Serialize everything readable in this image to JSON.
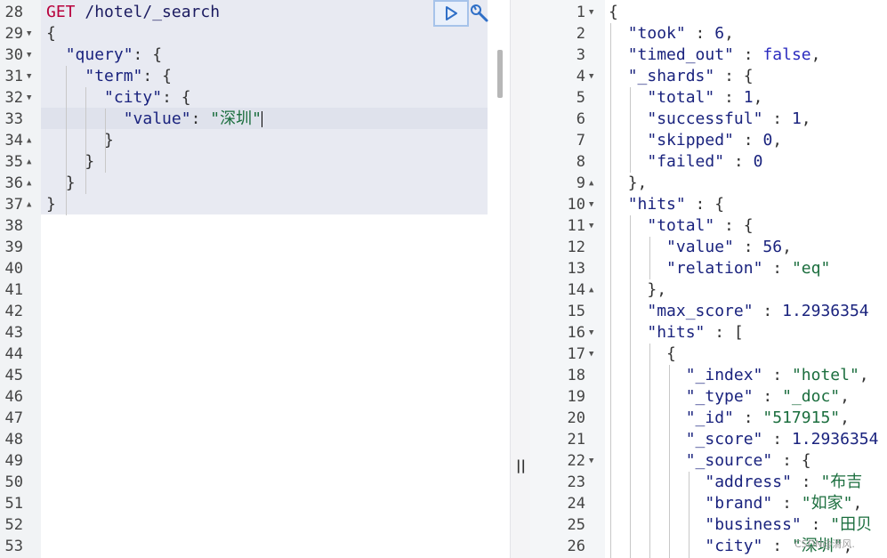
{
  "request": {
    "method": "GET",
    "path": " /hotel/_search",
    "lines": [
      {
        "num": "28",
        "fold": "",
        "text": ""
      },
      {
        "num": "29",
        "fold": "▼",
        "text": "{"
      },
      {
        "num": "30",
        "fold": "▼",
        "text": "  \"query\": {"
      },
      {
        "num": "31",
        "fold": "▼",
        "text": "    \"term\": {"
      },
      {
        "num": "32",
        "fold": "▼",
        "text": "      \"city\": {"
      },
      {
        "num": "33",
        "fold": "",
        "text": "        \"value\": \"深圳\""
      },
      {
        "num": "34",
        "fold": "▲",
        "text": "      }"
      },
      {
        "num": "35",
        "fold": "▲",
        "text": "    }"
      },
      {
        "num": "36",
        "fold": "▲",
        "text": "  }"
      },
      {
        "num": "37",
        "fold": "▲",
        "text": "}"
      },
      {
        "num": "38",
        "fold": "",
        "text": ""
      },
      {
        "num": "39",
        "fold": "",
        "text": ""
      },
      {
        "num": "40",
        "fold": "",
        "text": ""
      },
      {
        "num": "41",
        "fold": "",
        "text": ""
      },
      {
        "num": "42",
        "fold": "",
        "text": ""
      },
      {
        "num": "43",
        "fold": "",
        "text": ""
      },
      {
        "num": "44",
        "fold": "",
        "text": ""
      },
      {
        "num": "45",
        "fold": "",
        "text": ""
      },
      {
        "num": "46",
        "fold": "",
        "text": ""
      },
      {
        "num": "47",
        "fold": "",
        "text": ""
      },
      {
        "num": "48",
        "fold": "",
        "text": ""
      },
      {
        "num": "49",
        "fold": "",
        "text": ""
      },
      {
        "num": "50",
        "fold": "",
        "text": ""
      },
      {
        "num": "51",
        "fold": "",
        "text": ""
      },
      {
        "num": "52",
        "fold": "",
        "text": ""
      },
      {
        "num": "53",
        "fold": "",
        "text": ""
      }
    ]
  },
  "response": {
    "lines": [
      {
        "num": "1",
        "fold": "▼",
        "text": "{"
      },
      {
        "num": "2",
        "fold": "",
        "text": "  \"took\" : 6,"
      },
      {
        "num": "3",
        "fold": "",
        "text": "  \"timed_out\" : false,"
      },
      {
        "num": "4",
        "fold": "▼",
        "text": "  \"_shards\" : {"
      },
      {
        "num": "5",
        "fold": "",
        "text": "    \"total\" : 1,"
      },
      {
        "num": "6",
        "fold": "",
        "text": "    \"successful\" : 1,"
      },
      {
        "num": "7",
        "fold": "",
        "text": "    \"skipped\" : 0,"
      },
      {
        "num": "8",
        "fold": "",
        "text": "    \"failed\" : 0"
      },
      {
        "num": "9",
        "fold": "▲",
        "text": "  },"
      },
      {
        "num": "10",
        "fold": "▼",
        "text": "  \"hits\" : {"
      },
      {
        "num": "11",
        "fold": "▼",
        "text": "    \"total\" : {"
      },
      {
        "num": "12",
        "fold": "",
        "text": "      \"value\" : 56,"
      },
      {
        "num": "13",
        "fold": "",
        "text": "      \"relation\" : \"eq\""
      },
      {
        "num": "14",
        "fold": "▲",
        "text": "    },"
      },
      {
        "num": "15",
        "fold": "",
        "text": "    \"max_score\" : 1.2936354"
      },
      {
        "num": "16",
        "fold": "▼",
        "text": "    \"hits\" : ["
      },
      {
        "num": "17",
        "fold": "▼",
        "text": "      {"
      },
      {
        "num": "18",
        "fold": "",
        "text": "        \"_index\" : \"hotel\","
      },
      {
        "num": "19",
        "fold": "",
        "text": "        \"_type\" : \"_doc\","
      },
      {
        "num": "20",
        "fold": "",
        "text": "        \"_id\" : \"517915\","
      },
      {
        "num": "21",
        "fold": "",
        "text": "        \"_score\" : 1.2936354"
      },
      {
        "num": "22",
        "fold": "▼",
        "text": "        \"_source\" : {"
      },
      {
        "num": "23",
        "fold": "",
        "text": "          \"address\" : \"布吉"
      },
      {
        "num": "24",
        "fold": "",
        "text": "          \"brand\" : \"如家\","
      },
      {
        "num": "25",
        "fold": "",
        "text": "          \"business\" : \"田贝"
      },
      {
        "num": "26",
        "fold": "",
        "text": "          \"city\" : \"深圳\","
      }
    ]
  },
  "splitter": {
    "grip": "||"
  },
  "watermark": "CSDN@清风.",
  "icons": {
    "run": "play-icon",
    "settings": "wrench-icon"
  },
  "colors": {
    "method": "#b8003c",
    "string": "#1b6e3e",
    "key": "#1a237e",
    "boolean": "#2b2bbf",
    "run_border": "#a6c3ea"
  }
}
